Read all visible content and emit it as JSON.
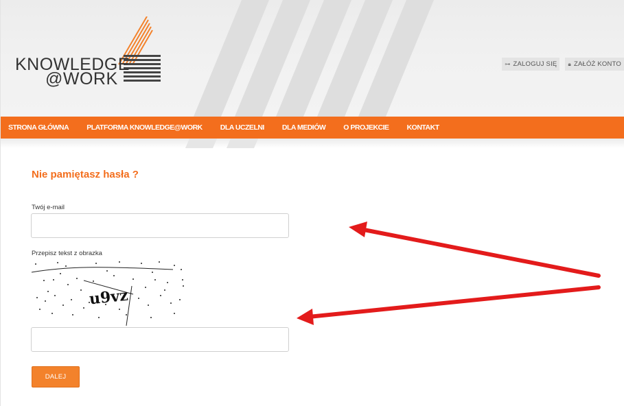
{
  "brand": {
    "line1": "KNOWLEDGE",
    "line2": "@WORK"
  },
  "auth": {
    "login_label": "ZALOGUJ SIĘ",
    "register_label": "ZAŁÓŻ KONTO"
  },
  "nav": {
    "items": [
      {
        "label": "STRONA GŁÓWNA"
      },
      {
        "label": "PLATFORMA KNOWLEDGE@WORK"
      },
      {
        "label": "DLA UCZELNI"
      },
      {
        "label": "DLA MEDIÓW"
      },
      {
        "label": "O PROJEKCIE"
      },
      {
        "label": "KONTAKT"
      }
    ]
  },
  "form": {
    "title": "Nie pamiętasz hasła ?",
    "email_label": "Twój e-mail",
    "email_value": "",
    "captcha_label": "Przepisz tekst z obrazka",
    "captcha_text": "u9vz",
    "captcha_value": "",
    "submit_label": "DALEJ"
  },
  "colors": {
    "accent": "#f36e1d",
    "button": "#f3822b",
    "arrow": "#e31b1b",
    "header_bg": "#efefef"
  },
  "icons": {
    "login": "key-icon",
    "register": "lock-icon"
  }
}
